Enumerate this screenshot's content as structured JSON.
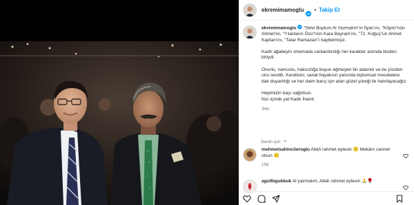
{
  "post": {
    "username": "ekremimamoglu",
    "follow_label": "Takip Et",
    "separator": "•",
    "caption_lines": [
      "\"Selvi Boylum Al Yazmalım\"ın İlyas'ını, \"Köprü\"nün Ahmet'ini, \"Yılanların Öcü\"nün Kara Bayram'ını, \"72. Koğuş\"un Ahmet Kaptan'ını, \"Tatar Ramazan\"ı kaybetmişiz.",
      "Kadir ağabeyin sinemada canlandırdığı her karakter aslında bizden biriydi.",
      "Onurlu, namuslu, haksızlığa boyun eğmeyen bir adamdı ve bu yüzden onu sevdik. Kendisini, sanat hayatının yanında toplumsal meselelere dair duyarlılığı ve her daim barış için atan güzel yüreği ile hatırlayacağız.",
      "Hepimizin başı sağolsun.",
      "Nur içinde yat Kadir İnanır."
    ],
    "caption_time": "34d",
    "translate_label": "Senin için",
    "comments": [
      {
        "username": "mehmetsahincileroglu",
        "text": "Allah rahmet eylesin 🙂 Mekânı cennet olsun 🙂",
        "time": "19d"
      },
      {
        "username": "agullbgubbuk",
        "text": "Al yazmalım, Allah rahmet eylesin 🙏🌹",
        "time": ""
      }
    ]
  },
  "icons": {
    "verified": "verified-badge-icon",
    "heart": "heart-icon",
    "comment": "comment-icon",
    "share": "share-icon",
    "save": "bookmark-icon",
    "chevron": "chevron-down-icon"
  },
  "colors": {
    "link_blue": "#0095f6",
    "verified_blue": "#0095f6",
    "text": "#262626",
    "muted": "#737373"
  }
}
